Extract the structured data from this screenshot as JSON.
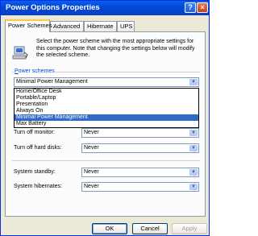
{
  "window": {
    "title": "Power Options Properties",
    "help_label": "?",
    "close_label": "×"
  },
  "tabs": [
    {
      "label": "Power Schemes",
      "active": true
    },
    {
      "label": "Advanced",
      "active": false
    },
    {
      "label": "Hibernate",
      "active": false
    },
    {
      "label": "UPS",
      "active": false
    }
  ],
  "description": "Select the power scheme with the most appropriate settings for this computer. Note that changing the settings below will modify the selected scheme.",
  "power_schemes": {
    "group_label": "Power schemes",
    "selected": "Minimal Power Management",
    "options": [
      "Home/Office Desk",
      "Portable/Laptop",
      "Presentation",
      "Always On",
      "Minimal Power Management",
      "Max Battery"
    ],
    "highlighted": "Minimal Power Management"
  },
  "settings": {
    "monitor_label": "Turn off monitor:",
    "monitor_value": "Never",
    "disks_label": "Turn off hard disks:",
    "disks_value": "Never",
    "standby_label": "System standby:",
    "standby_value": "Never",
    "hibernate_label": "System hibernates:",
    "hibernate_value": "Never"
  },
  "buttons": {
    "ok": "OK",
    "cancel": "Cancel",
    "apply": "Apply"
  }
}
